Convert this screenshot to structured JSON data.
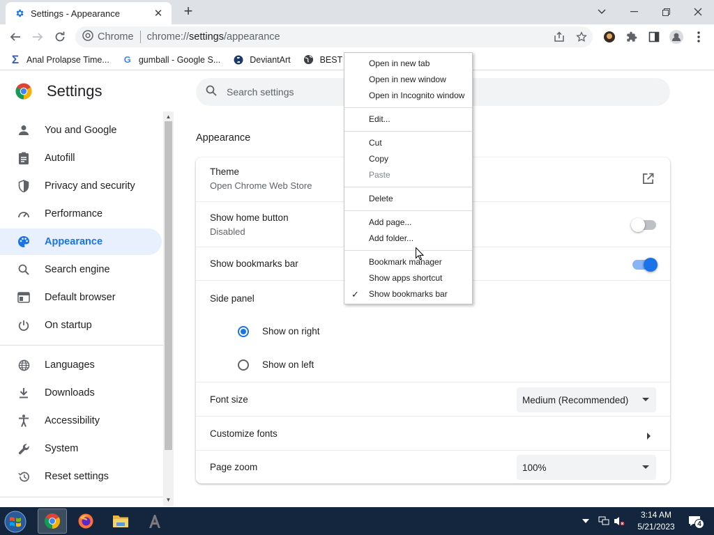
{
  "tab": {
    "title": "Settings - Appearance",
    "close": "✕"
  },
  "newtab": "+",
  "omnibox": {
    "site": "Chrome",
    "url_prefix": "chrome://",
    "url_host": "settings",
    "url_path": "/appearance"
  },
  "bookmarks": [
    {
      "label": "Anal Prolapse Time...",
      "icon": "sigma-icon"
    },
    {
      "label": "gumball - Google S...",
      "icon": "google-icon"
    },
    {
      "label": "DeviantArt",
      "icon": "deviantart-icon"
    },
    {
      "label": "BEST O",
      "icon": "globe-icon"
    }
  ],
  "settings": {
    "title": "Settings",
    "search_placeholder": "Search settings"
  },
  "sidebar": {
    "items": [
      {
        "label": "You and Google",
        "icon": "person-icon"
      },
      {
        "label": "Autofill",
        "icon": "clipboard-icon"
      },
      {
        "label": "Privacy and security",
        "icon": "shield-icon"
      },
      {
        "label": "Performance",
        "icon": "speedometer-icon"
      },
      {
        "label": "Appearance",
        "icon": "palette-icon",
        "active": true
      },
      {
        "label": "Search engine",
        "icon": "search-icon"
      },
      {
        "label": "Default browser",
        "icon": "browser-icon"
      },
      {
        "label": "On startup",
        "icon": "power-icon"
      },
      {
        "label": "Languages",
        "icon": "globe-icon"
      },
      {
        "label": "Downloads",
        "icon": "download-icon"
      },
      {
        "label": "Accessibility",
        "icon": "accessibility-icon"
      },
      {
        "label": "System",
        "icon": "wrench-icon"
      },
      {
        "label": "Reset settings",
        "icon": "history-icon"
      }
    ]
  },
  "appearance": {
    "section_title": "Appearance",
    "theme": {
      "label": "Theme",
      "sub": "Open Chrome Web Store"
    },
    "home_button": {
      "label": "Show home button",
      "sub": "Disabled",
      "enabled": false
    },
    "bookmarks_bar": {
      "label": "Show bookmarks bar",
      "enabled": true
    },
    "side_panel": {
      "label": "Side panel",
      "option_right": "Show on right",
      "option_left": "Show on left",
      "selected": "right"
    },
    "font_size": {
      "label": "Font size",
      "value": "Medium (Recommended)"
    },
    "customize_fonts": {
      "label": "Customize fonts"
    },
    "page_zoom": {
      "label": "Page zoom",
      "value": "100%"
    }
  },
  "context_menu": {
    "items": [
      {
        "label": "Open in new tab"
      },
      {
        "label": "Open in new window"
      },
      {
        "label": "Open in Incognito window"
      },
      {
        "label": "Edit..."
      },
      {
        "label": "Cut"
      },
      {
        "label": "Copy"
      },
      {
        "label": "Paste",
        "disabled": true
      },
      {
        "label": "Delete"
      },
      {
        "label": "Add page..."
      },
      {
        "label": "Add folder..."
      },
      {
        "label": "Bookmark manager"
      },
      {
        "label": "Show apps shortcut"
      },
      {
        "label": "Show bookmarks bar",
        "checked": true
      }
    ],
    "check": "✓"
  },
  "taskbar": {
    "time": "3:14 AM",
    "date": "5/21/2023",
    "notification_count": "4"
  },
  "colors": {
    "accent": "#1a73e8",
    "taskbar": "#13263d",
    "active_nav_bg": "#e8f0fe"
  }
}
